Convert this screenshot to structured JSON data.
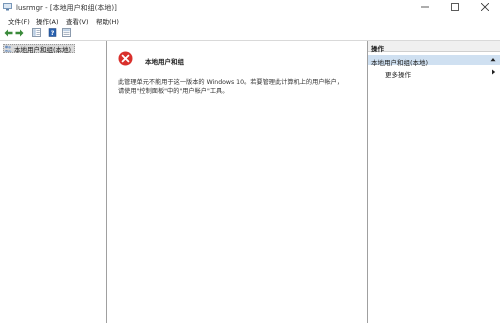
{
  "window": {
    "title": "lusrmgr - [本地用户和组(本地)]"
  },
  "menu": [
    {
      "label": "文件(F)"
    },
    {
      "label": "操作(A)"
    },
    {
      "label": "查看(V)"
    },
    {
      "label": "帮助(H)"
    }
  ],
  "tree": {
    "root_label": "本地用户和组(本地)"
  },
  "center": {
    "error_title": "本地用户和组",
    "error_line1": "此管理单元不能用于这一版本的 Windows 10。若要管理此计算机上的用户帐户，",
    "error_line2": "请使用\"控制面板\"中的\"用户帐户\"工具。"
  },
  "actions": {
    "header": "操作",
    "group_label": "本地用户和组(本地)",
    "more_label": "更多操作"
  },
  "colors": {
    "selection": "#cfe0f1",
    "error_red": "#d9302c"
  }
}
